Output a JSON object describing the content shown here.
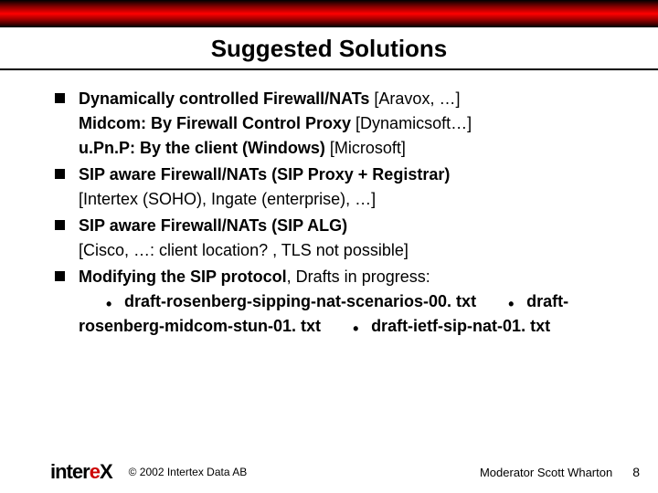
{
  "title": "Suggested Solutions",
  "bullets": [
    {
      "lines": [
        {
          "bold": "Dynamically controlled Firewall/NATs",
          "rest": " [Aravox, …]"
        },
        {
          "bold": "Midcom: By Firewall Control Proxy",
          "rest": " [Dynamicsoft…]"
        },
        {
          "bold": "u.Pn.P: By the client (Windows)",
          "rest": " [Microsoft]"
        }
      ]
    },
    {
      "lines": [
        {
          "bold": "SIP aware Firewall/NATs (SIP Proxy + Registrar)",
          "rest": ""
        },
        {
          "bold": "",
          "rest": "[Intertex (SOHO), Ingate (enterprise), …]"
        }
      ]
    },
    {
      "lines": [
        {
          "bold": "SIP aware Firewall/NATs (SIP ALG)",
          "rest": ""
        },
        {
          "bold": "",
          "rest": "[Cisco, …: client location? , TLS not possible]"
        }
      ]
    },
    {
      "lines": [
        {
          "bold": "Modifying the SIP protocol",
          "rest": ", Drafts in progress:"
        }
      ],
      "subs": [
        "draft-rosenberg-sipping-nat-scenarios-00. txt",
        "draft-rosenberg-midcom-stun-01. txt",
        "draft-ietf-sip-nat-01. txt"
      ]
    }
  ],
  "footer": {
    "logo_pre": "inter",
    "logo_mid": "e",
    "logo_post": "X",
    "copyright": "© 2002 Intertex Data AB",
    "moderator": "Moderator Scott Wharton",
    "page": "8"
  }
}
